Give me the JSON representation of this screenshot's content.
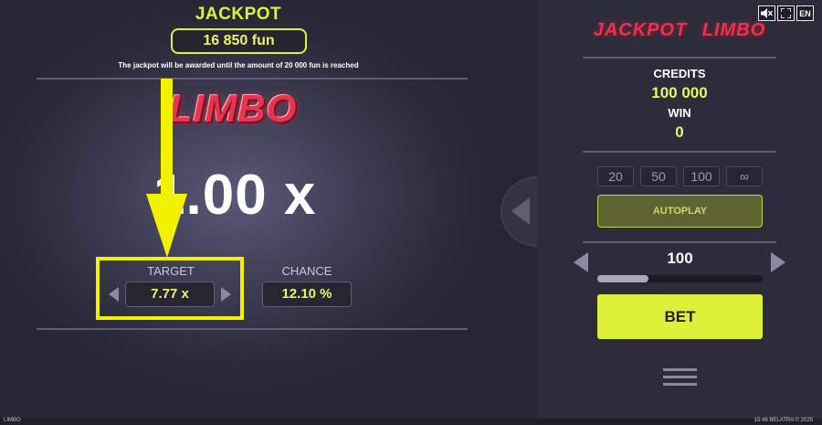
{
  "jackpot": {
    "title": "JACKPOT",
    "amount": "16 850 fun",
    "note": "The jackpot will be awarded until the amount of 20 000 fun is reached"
  },
  "game": {
    "logo": "LIMBO",
    "multiplier": "1.00 x",
    "target_label": "TARGET",
    "target_value": "7.77 x",
    "chance_label": "CHANCE",
    "chance_value": "12.10 %"
  },
  "panel": {
    "icons": {
      "sound": "sound-muted-icon",
      "fullscreen": "fullscreen-icon",
      "language": "EN"
    },
    "title_logo": "JACKPOT LIMBO",
    "credits_label": "CREDITS",
    "credits_value": "100 000",
    "win_label": "WIN",
    "win_value": "0",
    "chips": [
      "20",
      "50",
      "100",
      "∞"
    ],
    "autoplay_label": "AUTOPLAY",
    "bet_value": "100",
    "bet_level_fraction": 0.31,
    "bet_label": "BET"
  },
  "footer": {
    "game_name": "LIMBO",
    "time_copyright": "15:48  BELATRA © 2025"
  },
  "colors": {
    "accent": "#def03a",
    "logo_red": "#e8344f",
    "highlight": "#f2f200"
  }
}
